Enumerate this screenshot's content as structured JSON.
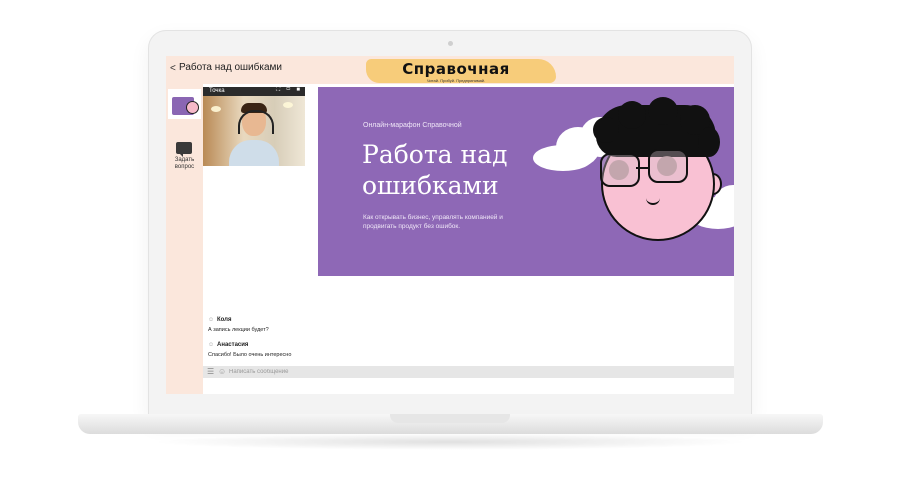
{
  "header": {
    "back_icon": "share-icon",
    "title": "Работа над ошибками",
    "logo": "Справочная",
    "logo_sub": "Читай. Пробуй. Предпринимай."
  },
  "sidebar": {
    "ask_label": "Задать вопрос",
    "ask_icon": "chat-bubble-icon"
  },
  "video": {
    "title": "Точка",
    "controls": "⛶ ▭ ■"
  },
  "banner": {
    "kicker": "Онлайн-марафон Справочной",
    "title": "Работа над ошибками",
    "description": "Как открывать бизнес, управлять компанией и продвигать продукт без ошибок.",
    "color": "#8e68b6"
  },
  "chat": {
    "messages": [
      {
        "user": "Коля",
        "text": "А запись лекции будет?"
      },
      {
        "user": "Анастасия",
        "text": "Спасибо! Было очень интересно"
      }
    ]
  },
  "composer": {
    "placeholder": "Написать сообщение"
  }
}
